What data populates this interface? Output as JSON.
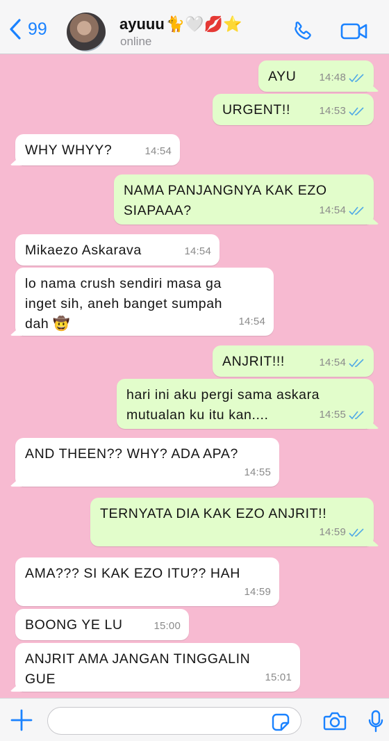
{
  "header": {
    "back_count": "99",
    "contact_name": "ayuuu",
    "name_emoji": "🐈🤍💋⭐",
    "status": "online"
  },
  "messages": [
    {
      "dir": "out",
      "text": "AYU",
      "time": "14:48",
      "read": true
    },
    {
      "dir": "out",
      "text": "URGENT!!",
      "time": "14:53",
      "read": true
    },
    {
      "dir": "in",
      "text": "WHY WHYY?",
      "time": "14:54"
    },
    {
      "dir": "out",
      "text": "NAMA PANJANGNYA KAK EZO\nSIAPAAA?",
      "time": "14:54",
      "read": true
    },
    {
      "dir": "in",
      "text": "Mikaezo Askarava",
      "time": "14:54"
    },
    {
      "dir": "in",
      "text": "lo nama crush sendiri masa ga\ninget sih, aneh banget sumpah\ndah 🤠",
      "time": "14:54"
    },
    {
      "dir": "out",
      "text": "ANJRIT!!!",
      "time": "14:54",
      "read": true
    },
    {
      "dir": "out",
      "text": "hari ini aku pergi sama askara\nmutualan ku itu kan....",
      "time": "14:55",
      "read": true
    },
    {
      "dir": "in",
      "text": "AND THEEN?? WHY? ADA APA?",
      "time": "14:55"
    },
    {
      "dir": "out",
      "text": "TERNYATA DIA KAK EZO ANJRIT!!",
      "time": "14:59",
      "read": true
    },
    {
      "dir": "in",
      "text": "AMA??? SI KAK EZO ITU?? HAH",
      "time": "14:59"
    },
    {
      "dir": "in",
      "text": "BOONG YE LU",
      "time": "15:00"
    },
    {
      "dir": "in",
      "text": "ANJRIT AMA JANGAN TINGGALIN\nGUE",
      "time": "15:01"
    }
  ],
  "input": {
    "placeholder": ""
  },
  "colors": {
    "chat_background": "#f7bad1",
    "outgoing_bubble": "#e2fdcb",
    "incoming_bubble": "#ffffff",
    "accent": "#1a82ff",
    "read_ticks": "#4fa8e6"
  },
  "icons": {
    "back": "chevron-left-icon",
    "call": "phone-icon",
    "video": "video-camera-icon",
    "attach": "plus-icon",
    "sticker": "sticker-icon",
    "camera": "camera-icon",
    "voice": "microphone-icon",
    "read": "double-check-icon"
  }
}
